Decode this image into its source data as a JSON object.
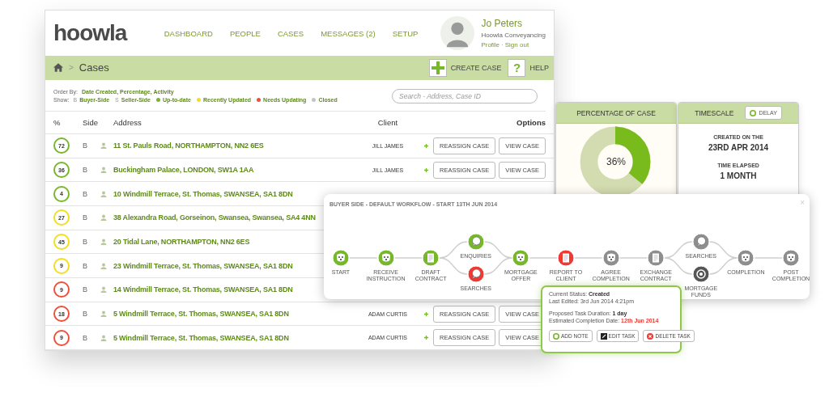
{
  "app": {
    "logo": "hoowla",
    "nav": [
      "DASHBOARD",
      "PEOPLE",
      "CASES",
      "MESSAGES (2)",
      "SETUP"
    ],
    "user": {
      "name": "Jo Peters",
      "company": "Hoowla Conveyancing",
      "links": [
        "Profile",
        "Sign out"
      ],
      "separator": "·"
    },
    "breadcrumb": {
      "separator": ">",
      "current": "Cases"
    },
    "toolbar": [
      {
        "kind": "plus",
        "label": "CREATE CASE"
      },
      {
        "kind": "help",
        "glyph": "?",
        "label": "HELP"
      }
    ],
    "order_by": {
      "label": "Order By:",
      "value": "Date Created, Percentage, Activity"
    },
    "show": {
      "label": "Show:",
      "items": [
        {
          "kind": "letter",
          "mark": "B",
          "label": "Buyer-Side"
        },
        {
          "kind": "letter",
          "mark": "S",
          "label": "Seller-Side"
        },
        {
          "kind": "dot",
          "color": "#77b82a",
          "label": "Up-to-date"
        },
        {
          "kind": "dot",
          "color": "#f3dd1c",
          "label": "Recently Updated"
        },
        {
          "kind": "dot",
          "color": "#f0503a",
          "label": "Needs Updating"
        },
        {
          "kind": "dot",
          "color": "#c4c4c4",
          "label": "Closed"
        }
      ]
    },
    "search": {
      "placeholder": "Search - Address, Case ID"
    },
    "table": {
      "columns": [
        "%",
        "Side",
        "Address",
        "Client",
        "Options"
      ],
      "rows": [
        {
          "percent": "72",
          "color": "#77b82a",
          "side": "B",
          "address": "11 St. Pauls Road, NORTHAMPTON, NN2 6ES",
          "client": "JILL JAMES",
          "actions": [
            "REASSIGN CASE",
            "VIEW CASE"
          ]
        },
        {
          "percent": "36",
          "color": "#77b82a",
          "side": "B",
          "address": "Buckingham Palace, LONDON, SW1A 1AA",
          "client": "JILL JAMES",
          "actions": [
            "REASSIGN CASE",
            "VIEW CASE"
          ]
        },
        {
          "percent": "4",
          "color": "#77b82a",
          "side": "B",
          "address": "10 Windmill Terrace, St. Thomas, SWANSEA, SA1 8DN"
        },
        {
          "percent": "27",
          "color": "#f3dd1c",
          "side": "B",
          "address": "38 Alexandra Road, Gorseinon, Swansea, Swansea, SA4 4NN"
        },
        {
          "percent": "45",
          "color": "#f3dd1c",
          "side": "B",
          "address": "20 Tidal Lane, NORTHAMPTON, NN2 6ES"
        },
        {
          "percent": "9",
          "color": "#f3dd1c",
          "side": "B",
          "address": "23 Windmill Terrace, St. Thomas, SWANSEA, SA1 8DN"
        },
        {
          "percent": "9",
          "color": "#f0503a",
          "side": "B",
          "address": "14 Windmill Terrace, St. Thomas, SWANSEA, SA1 8DN"
        },
        {
          "percent": "18",
          "color": "#f0503a",
          "side": "B",
          "address": "5 Windmill Terrace, St. Thomas, SWANSEA, SA1 8DN",
          "client": "ADAM CURTIS",
          "actions": [
            "REASSIGN CASE",
            "VIEW CASE"
          ]
        },
        {
          "percent": "9",
          "color": "#f0503a",
          "side": "B",
          "address": "5 Windmill Terrace, St. Thomas, SWANSEA, SA1 8DN",
          "client": "ADAM CURTIS",
          "actions": [
            "REASSIGN CASE",
            "VIEW CASE"
          ]
        }
      ]
    }
  },
  "percentage_card": {
    "title": "PERCENTAGE OF CASE",
    "level": 0.36,
    "reading": "36%"
  },
  "timescale_card": {
    "title": "TIMESCALE",
    "button": "DELAY",
    "fields": [
      {
        "label": "CREATED ON THE",
        "value": "23RD APR 2014"
      },
      {
        "label": "TIME ELAPSED",
        "value": "1 MONTH"
      }
    ]
  },
  "workflow": {
    "title": "BUYER SIDE - DEFAULT WORKFLOW - START 13TH JUN 2014",
    "close": "×",
    "steps": [
      {
        "kind": "single",
        "nodes": [
          {
            "label": "START",
            "color": "#77b82a",
            "kind": "dog"
          }
        ]
      },
      {
        "kind": "single",
        "nodes": [
          {
            "label": "RECEIVE INSTRUCTION",
            "color": "#77b82a",
            "kind": "dog"
          }
        ]
      },
      {
        "kind": "single",
        "nodes": [
          {
            "label": "DRAFT CONTRACT",
            "color": "#77b82a",
            "kind": "document"
          }
        ]
      },
      {
        "kind": "branch",
        "nodes": [
          {
            "label": "ENQUIRIES",
            "color": "#77b82a",
            "kind": "chat"
          },
          {
            "label": "SEARCHES",
            "color": "#ee3a33",
            "kind": "chat"
          }
        ]
      },
      {
        "kind": "single",
        "nodes": [
          {
            "label": "MORTGAGE OFFER",
            "color": "#77b82a",
            "kind": "dog"
          }
        ]
      },
      {
        "kind": "single",
        "nodes": [
          {
            "label": "REPORT TO CLIENT",
            "color": "#ee3a33",
            "kind": "document"
          }
        ]
      },
      {
        "kind": "single",
        "nodes": [
          {
            "label": "AGREE COMPLETION",
            "color": "#8e8e8e",
            "kind": "dog"
          }
        ]
      },
      {
        "kind": "single",
        "nodes": [
          {
            "label": "EXCHANGE CONTRACT",
            "color": "#8e8e8e",
            "kind": "document"
          }
        ]
      },
      {
        "kind": "branch",
        "nodes": [
          {
            "label": "SEARCHES",
            "color": "#8e8e8e",
            "kind": "chat"
          },
          {
            "label": "MORTGAGE FUNDS",
            "color": "#555555",
            "kind": "coin"
          }
        ]
      },
      {
        "kind": "single",
        "nodes": [
          {
            "label": "COMPLETION",
            "color": "#8e8e8e",
            "kind": "dog"
          }
        ]
      },
      {
        "kind": "single",
        "nodes": [
          {
            "label": "POST COMPLETION",
            "color": "#8e8e8e",
            "kind": "dog"
          }
        ]
      }
    ]
  },
  "task_popup": {
    "groups": [
      [
        {
          "label": "Current Status:",
          "value": "Created",
          "kind": "bold"
        },
        {
          "label": "Last Edited:",
          "value": "3rd Jun 2014 4:21pm",
          "kind": "plain"
        }
      ],
      [
        {
          "label": "Proposed Task Duration:",
          "value": "1 day",
          "kind": "bold"
        },
        {
          "label": "Estimated Completion Date:",
          "value": "12th Jun 2014",
          "kind": "alert"
        }
      ]
    ],
    "buttons": [
      {
        "kind": "add",
        "label": "ADD NOTE"
      },
      {
        "kind": "edit",
        "label": "EDIT TASK"
      },
      {
        "kind": "delete",
        "label": "DELETE TASK"
      }
    ]
  }
}
